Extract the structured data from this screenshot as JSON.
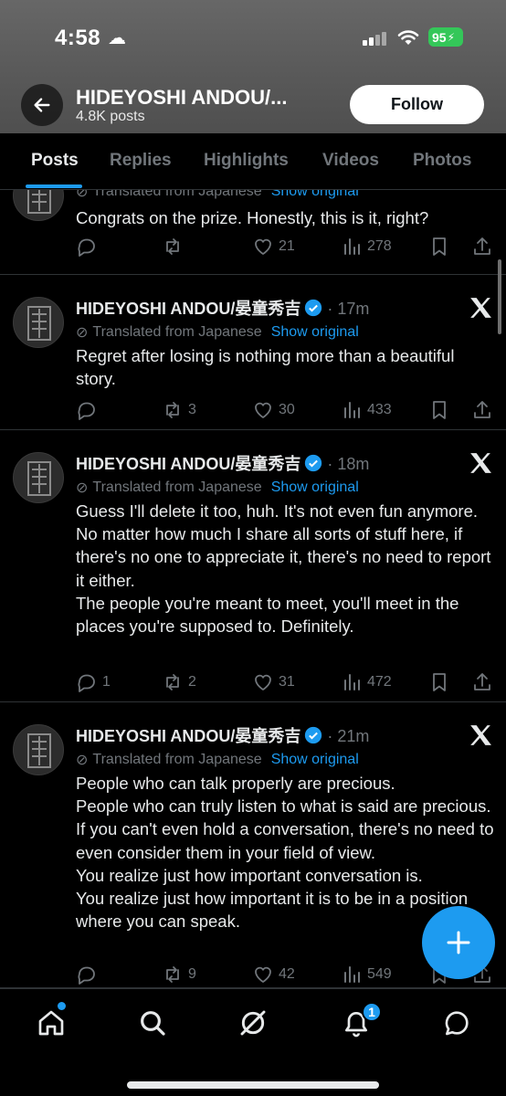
{
  "status_bar": {
    "time": "4:58",
    "battery": "95"
  },
  "header": {
    "name": "HIDEYOSHI ANDOU/...",
    "post_count": "4.8K posts",
    "follow_label": "Follow"
  },
  "tabs": [
    "Posts",
    "Replies",
    "Highlights",
    "Videos",
    "Photos"
  ],
  "active_tab": "Posts",
  "posts": [
    {
      "translated_label": "Translated from Japanese",
      "show_original": "Show original",
      "text": "Congrats on the prize. Honestly, this is it, right?",
      "replies": "",
      "reposts": "",
      "likes": "21",
      "views": "278"
    },
    {
      "author": "HIDEYOSHI ANDOU/晏童秀吉",
      "time": "17m",
      "translated_label": "Translated from Japanese",
      "show_original": "Show original",
      "text": "Regret after losing is nothing more than a beautiful story.",
      "replies": "",
      "reposts": "3",
      "likes": "30",
      "views": "433"
    },
    {
      "author": "HIDEYOSHI ANDOU/晏童秀吉",
      "time": "18m",
      "translated_label": "Translated from Japanese",
      "show_original": "Show original",
      "text": "Guess I'll delete it too, huh. It's not even fun anymore.\nNo matter how much I share all sorts of stuff here, if there's no one to appreciate it, there's no need to report it either.\nThe people you're meant to meet, you'll meet in the places you're supposed to. Definitely.",
      "replies": "1",
      "reposts": "2",
      "likes": "31",
      "views": "472"
    },
    {
      "author": "HIDEYOSHI ANDOU/晏童秀吉",
      "time": "21m",
      "translated_label": "Translated from Japanese",
      "show_original": "Show original",
      "text": "People who can talk properly are precious.\nPeople who can truly listen to what is said are precious.\nIf you can't even hold a conversation, there's no need to even consider them in your field of view.\nYou realize just how important conversation is.\nYou realize just how important it is to be in a position where you can speak.",
      "replies": "",
      "reposts": "9",
      "likes": "42",
      "views": "549"
    }
  ],
  "bottom_nav": {
    "notifications_badge": "1"
  },
  "colors": {
    "accent": "#1d9bf0",
    "background": "#000000",
    "muted": "#71767b",
    "text": "#e7e9ea"
  }
}
